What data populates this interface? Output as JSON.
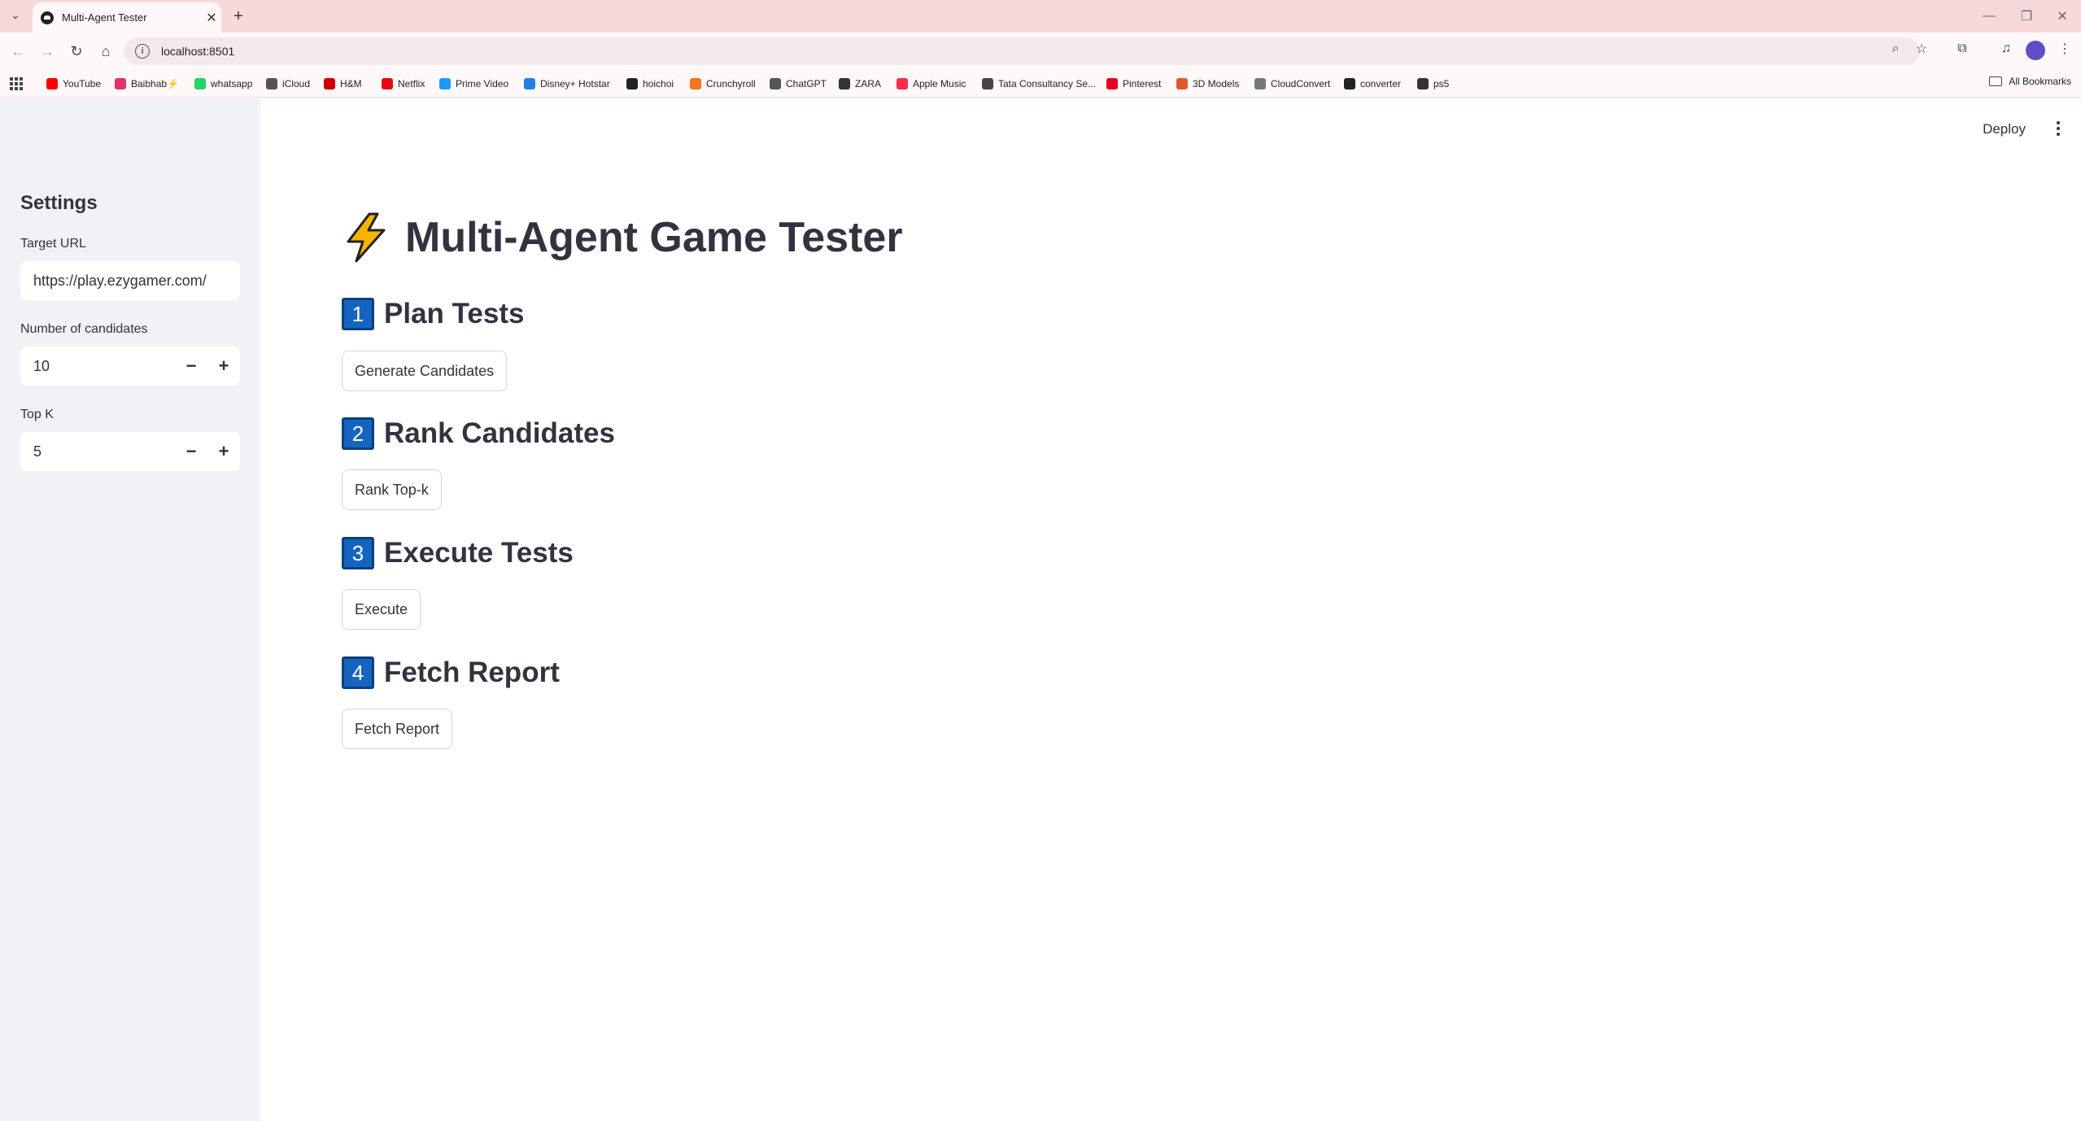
{
  "browser": {
    "tab_title": "Multi-Agent Tester",
    "address": "localhost:8501",
    "bookmarks": [
      {
        "label": "YouTube",
        "color": "#ff0000"
      },
      {
        "label": "Baibhab⚡",
        "color": "#e1306c"
      },
      {
        "label": "whatsapp",
        "color": "#25d366"
      },
      {
        "label": "iCloud",
        "color": "#555555"
      },
      {
        "label": "H&M",
        "color": "#cc0000"
      },
      {
        "label": "Netflix",
        "color": "#e50914"
      },
      {
        "label": "Prime Video",
        "color": "#1a98ff"
      },
      {
        "label": "Disney+ Hotstar",
        "color": "#1f80e0"
      },
      {
        "label": "hoichoi",
        "color": "#222222"
      },
      {
        "label": "Crunchyroll",
        "color": "#f47521"
      },
      {
        "label": "ChatGPT",
        "color": "#555555"
      },
      {
        "label": "ZARA",
        "color": "#333333"
      },
      {
        "label": "Apple Music",
        "color": "#fa2d48"
      },
      {
        "label": "Tata Consultancy Se...",
        "color": "#444444"
      },
      {
        "label": "Pinterest",
        "color": "#e60023"
      },
      {
        "label": "3D Models",
        "color": "#e05a2b"
      },
      {
        "label": "CloudConvert",
        "color": "#777777"
      },
      {
        "label": "converter",
        "color": "#222222"
      },
      {
        "label": "ps5",
        "color": "#333333"
      }
    ],
    "all_bookmarks": "All Bookmarks"
  },
  "sidebar": {
    "heading": "Settings",
    "target_url_label": "Target URL",
    "target_url_value": "https://play.ezygamer.com/",
    "num_candidates_label": "Number of candidates",
    "num_candidates_value": "10",
    "top_k_label": "Top K",
    "top_k_value": "5",
    "minus": "−",
    "plus": "+"
  },
  "header": {
    "deploy": "Deploy"
  },
  "main": {
    "title": "Multi-Agent Game Tester",
    "sections": [
      {
        "number": "1",
        "heading": "Plan Tests",
        "button": "Generate Candidates"
      },
      {
        "number": "2",
        "heading": "Rank Candidates",
        "button": "Rank Top-k"
      },
      {
        "number": "3",
        "heading": "Execute Tests",
        "button": "Execute"
      },
      {
        "number": "4",
        "heading": "Fetch Report",
        "button": "Fetch Report"
      }
    ]
  },
  "colors": {
    "sidebar_bg": "#f0f2f6",
    "number_box": "#1565c0",
    "tabstrip": "#f7d9db",
    "text": "#31333f"
  }
}
